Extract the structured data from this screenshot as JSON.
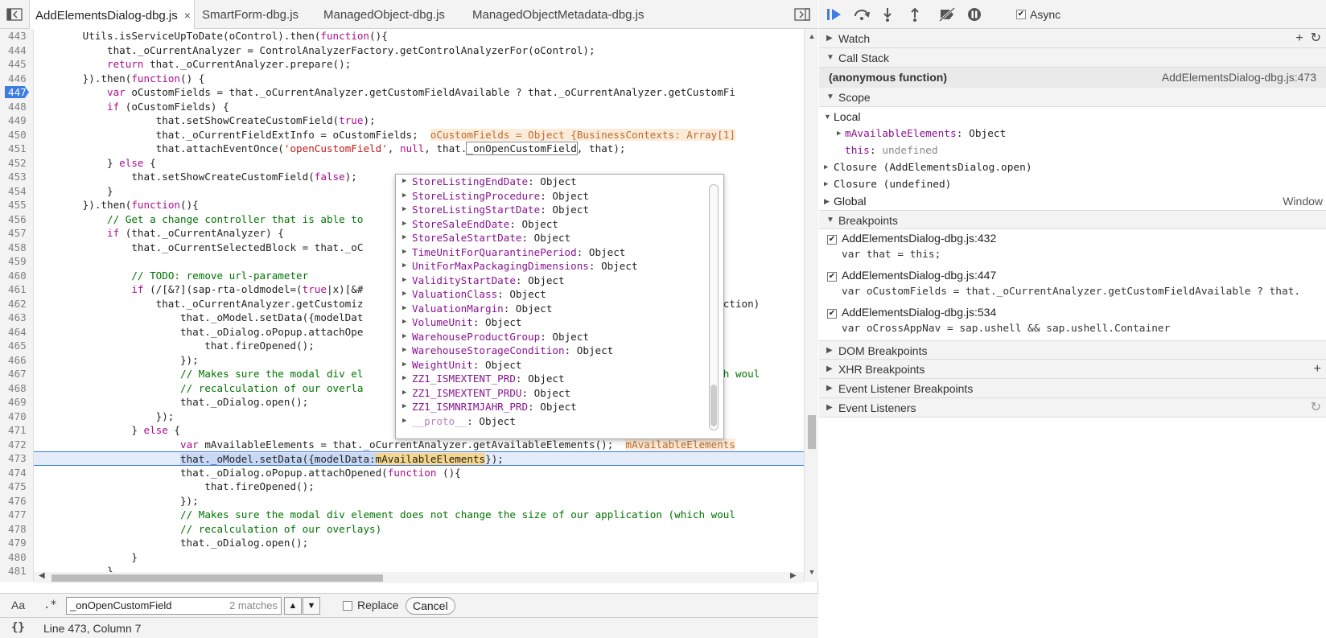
{
  "tabs": [
    {
      "label": "AddElementsDialog-dbg.js",
      "active": true
    },
    {
      "label": "SmartForm-dbg.js"
    },
    {
      "label": "ManagedObject-dbg.js"
    },
    {
      "label": "ManagedObjectMetadata-dbg.js"
    }
  ],
  "code": {
    "lines": [
      {
        "n": "443",
        "html": "        Utils.isServiceUpToDate(oControl).then(<span class=\"kw\">function</span>(){"
      },
      {
        "n": "444",
        "html": "            that._oCurrentAnalyzer = ControlAnalyzerFactory.getControlAnalyzerFor(oControl);"
      },
      {
        "n": "445",
        "html": "            <span class=\"kw\">return</span> that._oCurrentAnalyzer.prepare();"
      },
      {
        "n": "446",
        "html": "        }).then(<span class=\"kw\">function</span>() {"
      },
      {
        "n": "447",
        "html": "            <span class=\"kw\">var</span> oCustomFields = that._oCurrentAnalyzer.getCustomFieldAvailable ? that._oCurrentAnalyzer.getCustomFi",
        "bp": true
      },
      {
        "n": "448",
        "html": "            <span class=\"kw\">if</span> (oCustomFields) {"
      },
      {
        "n": "449",
        "html": "                    that.setShowCreateCustomField(<span class=\"kw\">true</span>);"
      },
      {
        "n": "450",
        "html": "                    that._oCurrentFieldExtInfo = oCustomFields;  <span class=\"inline-val\">oCustomFields = Object {BusinessContexts: Array[1]</span>"
      },
      {
        "n": "451",
        "html": "                    that.attachEventOnce(<span class=\"str\">'openCustomField'</span>, <span class=\"kw\">null</span>, that.<span class=\"hl-box\">_onOpenCustomField</span>, that);"
      },
      {
        "n": "452",
        "html": "            } <span class=\"kw\">else</span> {"
      },
      {
        "n": "453",
        "html": "                that.setShowCreateCustomField(<span class=\"kw\">false</span>);"
      },
      {
        "n": "454",
        "html": "            }"
      },
      {
        "n": "455",
        "html": "        }).then(<span class=\"kw\">function</span>(){"
      },
      {
        "n": "456",
        "html": "            <span class=\"cm\">// Get a change controller that is able to</span>"
      },
      {
        "n": "457",
        "html": "            <span class=\"kw\">if</span> (that._oCurrentAnalyzer) {"
      },
      {
        "n": "458",
        "html": "                that._oCurrentSelectedBlock = that._oC"
      },
      {
        "n": "459",
        "html": ""
      },
      {
        "n": "460",
        "html": "                <span class=\"cm\">// TODO: remove url-parameter</span>"
      },
      {
        "n": "461",
        "html": "                <span class=\"kw\">if</span> (/[&amp;?](sap-rta-oldmodel=(<span class=\"kw\">true</span>|x)[&amp;#"
      },
      {
        "n": "462",
        "html": "                    that._oCurrentAnalyzer.getCustomiz                                                     dCollection)"
      },
      {
        "n": "463",
        "html": "                        that._oModel.setData({modelDat"
      },
      {
        "n": "464",
        "html": "                        that._oDialog.oPopup.attachOpe"
      },
      {
        "n": "465",
        "html": "                            that.fireOpened();"
      },
      {
        "n": "466",
        "html": "                        });"
      },
      {
        "n": "467",
        "html": "                        <span class=\"cm\">// Makes sure the modal div el                                                      (which woul</span>"
      },
      {
        "n": "468",
        "html": "                        <span class=\"cm\">// recalculation of our overla</span>"
      },
      {
        "n": "469",
        "html": "                        that._oDialog.open();"
      },
      {
        "n": "470",
        "html": "                    });"
      },
      {
        "n": "471",
        "html": "                } <span class=\"kw\">else</span> {"
      },
      {
        "n": "472",
        "html": "                        <span class=\"kw\">var</span> mAvailableElements = that._oCurrentAnalyzer.getAvailableElements();  <span class=\"inline-val\">mAvailableElements</span>"
      },
      {
        "n": "473",
        "html": "                        <span class=\"hl-sel\">that._oModel.setData({modelData:</span><span class=\"hl-word\">mAvailableElements</span>});",
        "current": true
      },
      {
        "n": "474",
        "html": "                        that._oDialog.oPopup.attachOpened(<span class=\"kw\">function</span> (){"
      },
      {
        "n": "475",
        "html": "                            that.fireOpened();"
      },
      {
        "n": "476",
        "html": "                        });"
      },
      {
        "n": "477",
        "html": "                        <span class=\"cm\">// Makes sure the modal div element does not change the size of our application (which woul</span>"
      },
      {
        "n": "478",
        "html": "                        <span class=\"cm\">// recalculation of our overlays)</span>"
      },
      {
        "n": "479",
        "html": "                        that._oDialog.open();"
      },
      {
        "n": "480",
        "html": "                }"
      },
      {
        "n": "481",
        "html": "            }"
      },
      {
        "n": "482",
        "html": ""
      }
    ]
  },
  "popover": {
    "items": [
      {
        "key": "StoreListingEndDate",
        "val": "Object"
      },
      {
        "key": "StoreListingProcedure",
        "val": "Object"
      },
      {
        "key": "StoreListingStartDate",
        "val": "Object"
      },
      {
        "key": "StoreSaleEndDate",
        "val": "Object"
      },
      {
        "key": "StoreSaleStartDate",
        "val": "Object"
      },
      {
        "key": "TimeUnitForQuarantinePeriod",
        "val": "Object"
      },
      {
        "key": "UnitForMaxPackagingDimensions",
        "val": "Object"
      },
      {
        "key": "ValidityStartDate",
        "val": "Object"
      },
      {
        "key": "ValuationClass",
        "val": "Object"
      },
      {
        "key": "ValuationMargin",
        "val": "Object"
      },
      {
        "key": "VolumeUnit",
        "val": "Object"
      },
      {
        "key": "WarehouseProductGroup",
        "val": "Object"
      },
      {
        "key": "WarehouseStorageCondition",
        "val": "Object"
      },
      {
        "key": "WeightUnit",
        "val": "Object"
      },
      {
        "key": "ZZ1_ISMEXTENT_PRD",
        "val": "Object"
      },
      {
        "key": "ZZ1_ISMEXTENT_PRDU",
        "val": "Object"
      },
      {
        "key": "ZZ1_ISMNRIMJAHR_PRD",
        "val": "Object"
      },
      {
        "key": "__proto__",
        "val": "Object",
        "proto": true
      }
    ]
  },
  "search": {
    "case_label": "Aa",
    "regex_label": ".*",
    "value": "_onOpenCustomField",
    "matches": "2 matches",
    "prev": "▲",
    "next": "▼",
    "replace_label": "Replace",
    "cancel_label": "Cancel"
  },
  "status": {
    "pretty_label": "{}",
    "position": "Line 473, Column 7"
  },
  "debugger": {
    "async_label": "Async",
    "watch_label": "Watch",
    "callstack_label": "Call Stack",
    "callstack_frame": {
      "name": "(anonymous function)",
      "location": "AddElementsDialog-dbg.js:473"
    },
    "scope_label": "Scope",
    "scope": {
      "local_label": "Local",
      "local_items": [
        {
          "key": "mAvailableElements",
          "val": "Object",
          "expandable": true
        },
        {
          "key": "this",
          "val": "undefined",
          "undef": true
        }
      ],
      "closure1": "Closure (AddElementsDialog.open)",
      "closure2": "Closure (undefined)",
      "global_label": "Global",
      "global_value": "Window"
    },
    "breakpoints_label": "Breakpoints",
    "breakpoints": [
      {
        "location": "AddElementsDialog-dbg.js:432",
        "code": "var that = this;"
      },
      {
        "location": "AddElementsDialog-dbg.js:447",
        "code": "var oCustomFields = that._oCurrentAnalyzer.getCustomFieldAvailable ? that."
      },
      {
        "location": "AddElementsDialog-dbg.js:534",
        "code": "var oCrossAppNav = sap.ushell && sap.ushell.Container"
      }
    ],
    "dom_breakpoints_label": "DOM Breakpoints",
    "xhr_breakpoints_label": "XHR Breakpoints",
    "event_listener_breakpoints_label": "Event Listener Breakpoints",
    "event_listeners_label": "Event Listeners"
  },
  "colors": {
    "keyword": "#aa0d91",
    "string": "#c41a16",
    "comment": "#007400",
    "breakpoint": "#3d7de3",
    "property": "#881391"
  }
}
